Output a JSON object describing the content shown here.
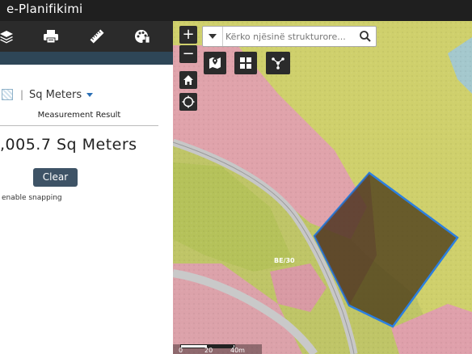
{
  "app": {
    "title": "e-Planifikimi"
  },
  "toolbar": {
    "items": [
      {
        "name": "layers-icon",
        "label": ""
      },
      {
        "name": "print-icon",
        "label": ""
      },
      {
        "name": "measure-icon",
        "label": ""
      },
      {
        "name": "palette-icon",
        "label": ""
      }
    ]
  },
  "measurement": {
    "unit": "Sq Meters",
    "title": "Measurement Result",
    "value": ",005.7 Sq Meters",
    "clear_label": "Clear",
    "snapping_text": "enable snapping"
  },
  "map": {
    "zoom_in": "+",
    "zoom_out": "−",
    "search": {
      "placeholder": "Kërko njësinë strukturore..."
    },
    "parcel_label": "BE/30",
    "scalebar": {
      "labels": [
        "0",
        "20",
        "40m"
      ]
    },
    "colors": {
      "residential": "#e3a0a8",
      "agricultural": "#c9d06a",
      "road": "#c2c2c2",
      "selection_outline": "#2b7fe0",
      "selection_fill": "#4a3a18"
    }
  }
}
